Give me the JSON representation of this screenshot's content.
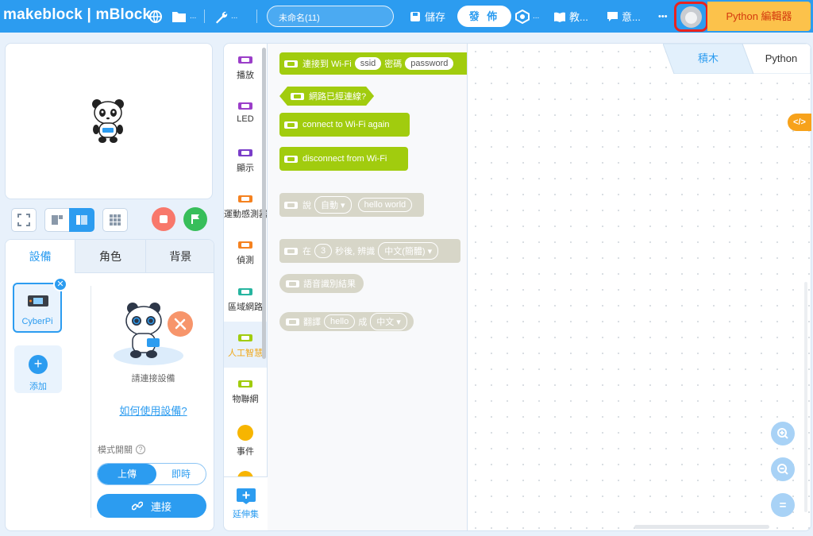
{
  "topbar": {
    "logo": "makeblock | mBlock",
    "project_name": "未命名(11)",
    "save_label": "儲存",
    "publish_label": "發 佈",
    "tutorials_label": "教...",
    "feedback_label": "意...",
    "more_label": "•••",
    "python_editor_label": "Python 編輯器"
  },
  "stage_controls": {
    "stop_color": "#f8786b",
    "go_color": "#37be5a"
  },
  "device_panel": {
    "tabs": [
      "設備",
      "角色",
      "背景"
    ],
    "device_name": "CyberPi",
    "add_label": "添加",
    "connect_hint": "請連接設備",
    "howto_link": "如何使用設備?",
    "mode_label": "模式開關",
    "mode_upload": "上傳",
    "mode_live": "即時",
    "connect_label": "連接"
  },
  "categories": [
    {
      "label": "播放",
      "color": "#9b3ec9"
    },
    {
      "label": "LED",
      "color": "#9b3ec9"
    },
    {
      "label": "顯示",
      "color": "#7a3ec9"
    },
    {
      "label": "運動感測器",
      "color": "#f58220"
    },
    {
      "label": "偵測",
      "color": "#f58220"
    },
    {
      "label": "區域網路",
      "color": "#27b5a0"
    },
    {
      "label": "人工智慧",
      "color": "#a1cc0e"
    },
    {
      "label": "物聯網",
      "color": "#a1cc0e"
    },
    {
      "label": "事件",
      "color": "#f7b500"
    }
  ],
  "extension_label": "延伸集",
  "blocks": {
    "wifi_connect": {
      "text": "連接到 Wi-Fi",
      "ssid": "ssid",
      "pwd_label": "密碼",
      "pwd": "password"
    },
    "wifi_connected": "網路已經連線?",
    "wifi_again": "connect to Wi-Fi again",
    "wifi_disconnect": "disconnect from Wi-Fi",
    "say": {
      "text": "說",
      "lang": "自動",
      "value": "hello world"
    },
    "recognize": {
      "pre": "在",
      "secs": "3",
      "mid": "秒後, 辨識",
      "lang": "中文(簡體)"
    },
    "speech_result": "語音識別結果",
    "translate": {
      "text": "翻譯",
      "value": "hello",
      "mid": "成",
      "lang": "中文"
    }
  },
  "workspace": {
    "tab_blocks": "積木",
    "tab_python": "Python",
    "code_toggle": "</>"
  },
  "zoom": {
    "in": "+",
    "out": "−",
    "reset": "="
  },
  "colors": {
    "brand": "#2c9cf0",
    "python_btn_bg": "#fcc24b",
    "python_btn_text": "#d43a0e",
    "highlight_border": "#e8231f",
    "ai_block": "#a1cc0e",
    "disabled_block": "#d7d6c8"
  }
}
